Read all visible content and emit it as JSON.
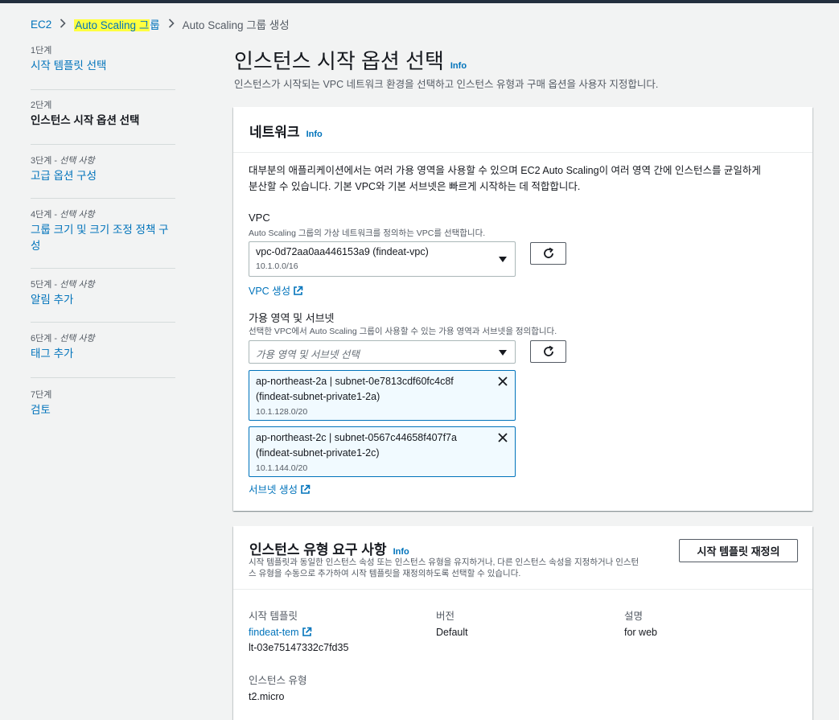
{
  "breadcrumb": {
    "root": "EC2",
    "parent_part1": "Auto Scaling ",
    "parent_part2": "그",
    "parent_part3": "룹",
    "current": "Auto Scaling 그룹 생성"
  },
  "steps": [
    {
      "label": "1단계",
      "optional": "",
      "title": "시작 템플릿 선택"
    },
    {
      "label": "2단계",
      "optional": "",
      "title": "인스턴스 시작 옵션 선택"
    },
    {
      "label": "3단계 - ",
      "optional": "선택 사항",
      "title": "고급 옵션 구성"
    },
    {
      "label": "4단계 - ",
      "optional": "선택 사항",
      "title": "그룹 크기 및 크기 조정 정책 구성"
    },
    {
      "label": "5단계 - ",
      "optional": "선택 사항",
      "title": "알림 추가"
    },
    {
      "label": "6단계 - ",
      "optional": "선택 사항",
      "title": "태그 추가"
    },
    {
      "label": "7단계",
      "optional": "",
      "title": "검토"
    }
  ],
  "page": {
    "title": "인스턴스 시작 옵션 선택",
    "info": "Info",
    "description": "인스턴스가 시작되는 VPC 네트워크 환경을 선택하고 인스턴스 유형과 구매 옵션을 사용자 지정합니다."
  },
  "network": {
    "heading": "네트워크",
    "info": "Info",
    "intro_line1": "대부분의 애플리케이션에서는 여러 가용 영역을 사용할 수 있으며 EC2 Auto Scaling이 여러 영역 간에 인스턴스를 균일하게",
    "intro_line2": "분산할 수 있습니다. 기본 VPC와 기본 서브넷은 빠르게 시작하는 데 적합합니다.",
    "vpc_label": "VPC",
    "vpc_desc": "Auto Scaling 그룹의 가상 네트워크를 정의하는 VPC를 선택합니다.",
    "vpc_value": "vpc-0d72aa0aa446153a9 (findeat-vpc)",
    "vpc_cidr": "10.1.0.0/16",
    "vpc_create": "VPC 생성",
    "az_label": "가용 영역 및 서브넷",
    "az_desc": "선택한 VPC에서 Auto Scaling 그룹이 사용할 수 있는 가용 영역과 서브넷을 정의합니다.",
    "az_placeholder": "가용 영역 및 서브넷 선택",
    "subnets": [
      {
        "line1": "ap-northeast-2a | subnet-0e7813cdf60fc4c8f",
        "line2": "(findeat-subnet-private1-2a)",
        "cidr": "10.1.128.0/20"
      },
      {
        "line1": "ap-northeast-2c | subnet-0567c44658f407f7a",
        "line2": "(findeat-subnet-private1-2c)",
        "cidr": "10.1.144.0/20"
      }
    ],
    "subnet_create": "서브넷 생성"
  },
  "instance_type": {
    "heading": "인스턴스 유형 요구 사항",
    "info": "Info",
    "desc_line1": "시작 템플릿과 동일한 인스턴스 속성 또는 인스턴스 유형을 유지하거나, 다른 인스턴스 속성을 지정하거나 인스턴",
    "desc_line2": "스 유형을 수동으로 추가하여 시작 템플릿을 재정의하도록 선택할 수 있습니다.",
    "override_button": "시작 템플릿 재정의",
    "template_label": "시작 템플릿",
    "template_name": "findeat-tem",
    "template_id": "lt-03e75147332c7fd35",
    "version_label": "버전",
    "version_value": "Default",
    "desc_label": "설명",
    "desc_value": "for web",
    "type_label": "인스턴스 유형",
    "type_value": "t2.micro"
  }
}
